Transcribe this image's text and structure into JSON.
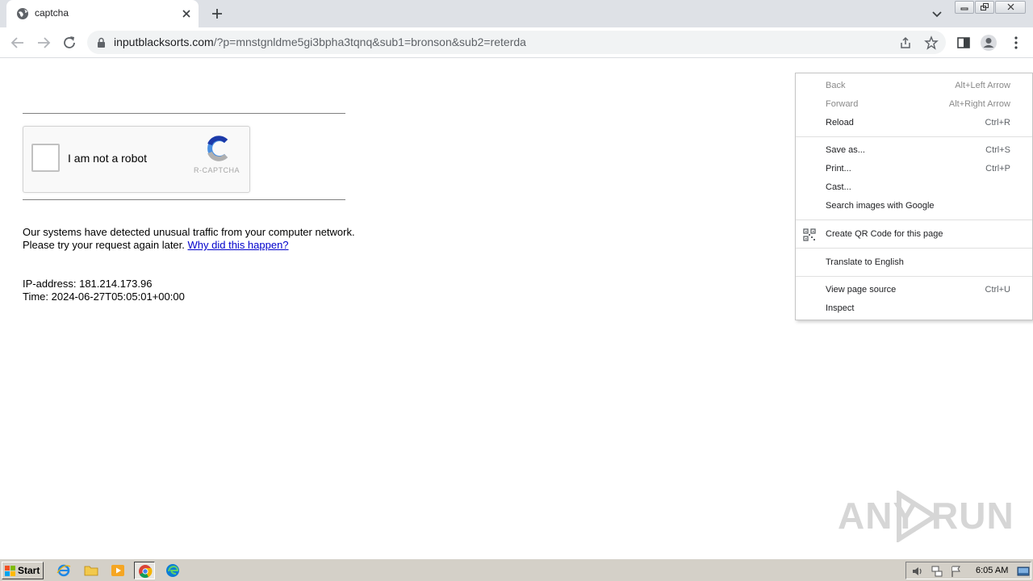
{
  "tab": {
    "title": "captcha"
  },
  "omnibox": {
    "url_host": "inputblacksorts.com",
    "url_path": "/?p=mnstgnldme5gi3bpha3tqnq&sub1=bronson&sub2=reterda"
  },
  "captcha": {
    "label": "I am not a robot",
    "brand": "R-CAPTCHA"
  },
  "message": {
    "text": "Our systems have detected unusual traffic from your computer network. Please try your request again later.",
    "link": "Why did this happen?"
  },
  "info": {
    "ip_line": "IP-address: 181.214.173.96",
    "time_line": "Time: 2024-06-27T05:05:01+00:00"
  },
  "context_menu": {
    "back": {
      "label": "Back",
      "shortcut": "Alt+Left Arrow"
    },
    "forward": {
      "label": "Forward",
      "shortcut": "Alt+Right Arrow"
    },
    "reload": {
      "label": "Reload",
      "shortcut": "Ctrl+R"
    },
    "save_as": {
      "label": "Save as...",
      "shortcut": "Ctrl+S"
    },
    "print": {
      "label": "Print...",
      "shortcut": "Ctrl+P"
    },
    "cast": {
      "label": "Cast..."
    },
    "search_images": {
      "label": "Search images with Google"
    },
    "create_qr": {
      "label": "Create QR Code for this page"
    },
    "translate": {
      "label": "Translate to English"
    },
    "view_source": {
      "label": "View page source",
      "shortcut": "Ctrl+U"
    },
    "inspect": {
      "label": "Inspect"
    }
  },
  "watermark": {
    "text_left": "ANY",
    "text_right": "RUN"
  },
  "taskbar": {
    "start_label": "Start",
    "clock": "6:05 AM"
  },
  "colors": {
    "tabstrip": "#dee1e6",
    "omnibox": "#f1f3f4",
    "link": "#0000cc",
    "taskbar": "#d4d0c8"
  },
  "icons": [
    "globe-icon",
    "close-icon",
    "plus-icon",
    "chevron-down-icon",
    "back-arrow-icon",
    "forward-arrow-icon",
    "reload-icon",
    "lock-icon",
    "share-icon",
    "star-icon",
    "side-panel-icon",
    "profile-icon",
    "kebab-menu-icon",
    "qr-code-icon",
    "windows-flag-icon",
    "ie-icon",
    "folder-icon",
    "media-player-icon",
    "chrome-icon",
    "edge-icon",
    "speaker-icon",
    "network-icon",
    "flag-icon",
    "desktop-icon"
  ]
}
